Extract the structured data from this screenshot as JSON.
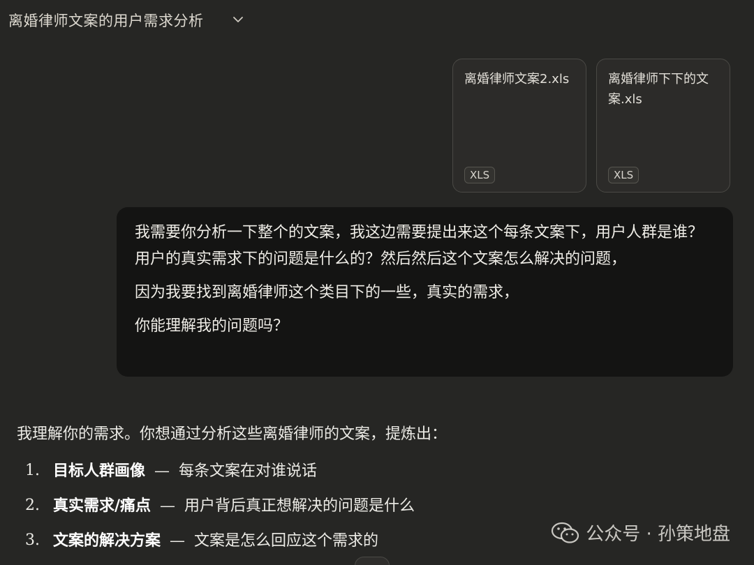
{
  "header": {
    "conversation_title": "离婚律师文案的用户需求分析"
  },
  "attachments": [
    {
      "name": "离婚律师文案2.xls",
      "type_badge": "XLS"
    },
    {
      "name": "离婚律师下下的文案.xls",
      "type_badge": "XLS"
    }
  ],
  "user_message": {
    "paragraphs": [
      "我需要你分析一下整个的文案，我这边需要提出来这个每条文案下，用户人群是谁？用户的真实需求下的问题是什么的？然后然后这个文案怎么解决的问题，",
      "因为我要找到离婚律师这个类目下的一些，真实的需求，",
      "你能理解我的问题吗？"
    ]
  },
  "assistant_message": {
    "intro": "我理解你的需求。你想通过分析这些离婚律师的文案，提炼出：",
    "items": [
      {
        "number": "1.",
        "bold": "目标人群画像",
        "dash": "—",
        "text": "每条文案在对谁说话"
      },
      {
        "number": "2.",
        "bold": "真实需求/痛点",
        "dash": "—",
        "text": "用户背后真正想解决的问题是什么"
      },
      {
        "number": "3.",
        "bold": "文案的解决方案",
        "dash": "—",
        "text": "文案是怎么回应这个需求的"
      }
    ]
  },
  "watermark": {
    "text": "公众号 · 孙策地盘",
    "icon": "wechat-icon"
  }
}
